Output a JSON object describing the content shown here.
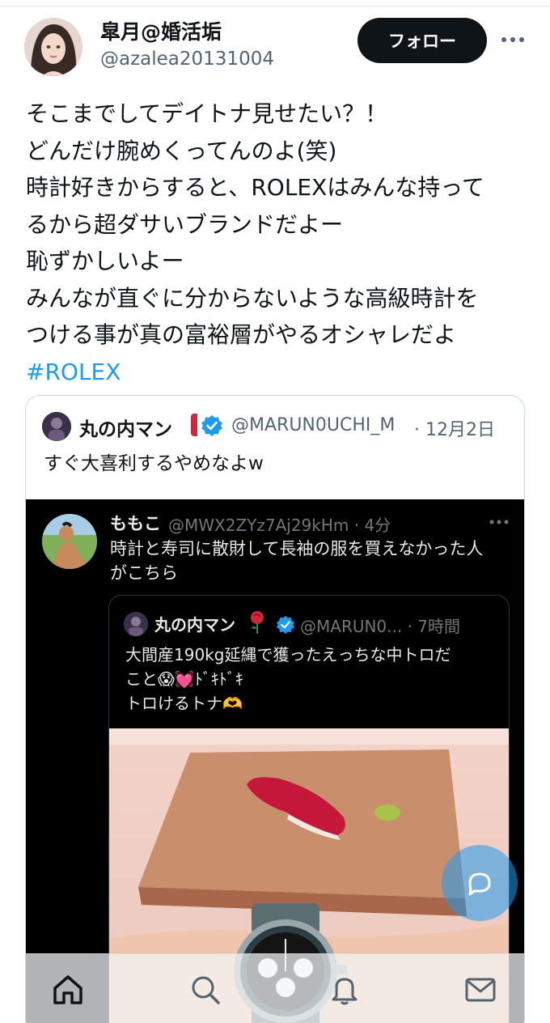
{
  "author": {
    "display_name": "皐月@婚活垢",
    "handle": "@azalea20131004",
    "avatar": "avatar-woman"
  },
  "actions": {
    "follow_label": "フォロー",
    "more": "more-icon"
  },
  "tweet": {
    "lines": [
      "そこまでしてデイトナ見せたい？！",
      "どんだけ腕めくってんのよ(笑)",
      "時計好きからすると、ROLEXはみんな持って",
      "るから超ダサいブランドだよー",
      "恥ずかしいよー",
      "みんなが直ぐに分からないような高級時計を",
      "つける事が真の富裕層がやるオシャレだよ"
    ],
    "hashtag": "#ROLEX"
  },
  "quoted": {
    "name": "丸の内マン",
    "handle": "@MARUN0UCHI_M",
    "date": "· 12月2日",
    "text": "すぐ大喜利するやめなよw",
    "verified": "verified-badge-icon",
    "screenshot": {
      "name": "ももこ",
      "handle": "@MWX2ZYz7Aj29kHm · 4分",
      "text_lines": [
        "時計と寿司に散財して長袖の服を買えなかった人",
        "がこちら"
      ],
      "inner": {
        "name": "丸の内マン",
        "handle": "@MARUN0... · 7時間",
        "text_lines": [
          "大間産190kg延縄で獲ったえっちな中トロだ",
          "こと😱💓ﾄﾞｷﾄﾞｷ",
          "トロけるトナ🫶"
        ],
        "photo": "sushi-plate-and-watch-photo"
      }
    }
  },
  "fab_icon": "reply-compose-icon",
  "nav": [
    "home-icon",
    "search-icon",
    "notifications-icon",
    "messages-icon"
  ],
  "colors": {
    "link": "#1d9bf0",
    "text": "#0f1419",
    "muted": "#536471",
    "follow_bg": "#0f1419"
  }
}
